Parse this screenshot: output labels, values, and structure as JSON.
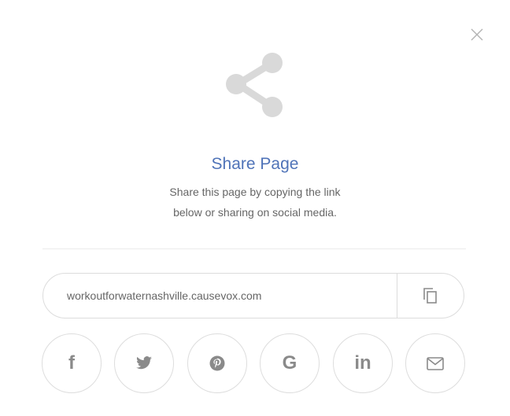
{
  "modal": {
    "title": "Share Page",
    "description_line1": "Share this page by copying the link",
    "description_line2": "below or sharing on social media."
  },
  "link": {
    "url": "workoutforwaternashville.causevox.com"
  },
  "social": [
    {
      "name": "facebook",
      "glyph": "f",
      "icon": "facebook-icon"
    },
    {
      "name": "twitter",
      "icon": "twitter-icon"
    },
    {
      "name": "pinterest",
      "icon": "pinterest-icon"
    },
    {
      "name": "google",
      "glyph": "G",
      "icon": "google-icon"
    },
    {
      "name": "linkedin",
      "glyph": "in",
      "icon": "linkedin-icon"
    },
    {
      "name": "email",
      "icon": "email-icon"
    }
  ],
  "colors": {
    "title": "#4f73b8",
    "icon_gray": "#8a8a8a",
    "illustration_gray": "#d9d9d9",
    "border": "#dcdcdc"
  }
}
